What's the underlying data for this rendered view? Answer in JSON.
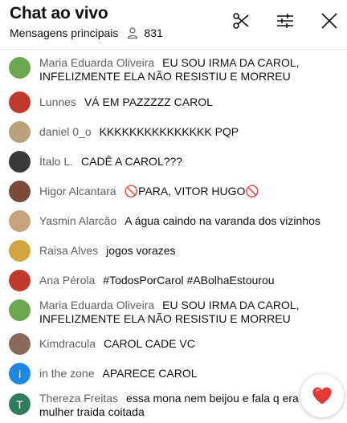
{
  "header": {
    "title": "Chat ao vivo",
    "mode_label": "Mensagens principais",
    "viewer_count": "831"
  },
  "messages": [
    {
      "author": "Maria Eduarda Oliveira",
      "text": "EU SOU IRMA DA CAROL, INFELIZMENTE ELA NÃO RESISTIU E MORREU",
      "avatar": "photo",
      "avatar_color": "#6aa84f"
    },
    {
      "author": "Lunnes",
      "text": "VÁ EM PAZZZZZ CAROL",
      "avatar": "photo",
      "avatar_color": "#c0392b"
    },
    {
      "author": "daniel 0_o",
      "text": "KKKKKKKKKKKKKKK PQP",
      "avatar": "photo",
      "avatar_color": "#b8a27a"
    },
    {
      "author": "Ítalo L.",
      "text": "CADÊ A CAROL???",
      "avatar": "photo",
      "avatar_color": "#3a3a3a"
    },
    {
      "author": "Higor Alcantara",
      "text": "🚫PARA, VITOR HUGO🚫",
      "avatar": "photo",
      "avatar_color": "#7a4a3a"
    },
    {
      "author": "Yasmin Alarcão",
      "text": "A água caindo na varanda dos vizinhos",
      "avatar": "photo",
      "avatar_color": "#c8a27a"
    },
    {
      "author": "Raisa Alves",
      "text": "jogos vorazes",
      "avatar": "photo",
      "avatar_color": "#d4a53c"
    },
    {
      "author": "Ana Pérola",
      "text": "#TodosPorCarol #ABolhaEstourou",
      "avatar": "photo",
      "avatar_color": "#c0392b"
    },
    {
      "author": "Maria Eduarda Oliveira",
      "text": "EU SOU IRMA DA CAROL, INFELIZMENTE ELA NÃO RESISTIU E MORREU",
      "avatar": "photo",
      "avatar_color": "#6aa84f"
    },
    {
      "author": "Kimdracula",
      "text": "CAROL CADE VC",
      "avatar": "photo",
      "avatar_color": "#8a6a5a"
    },
    {
      "author": "in the zone",
      "text": "APARECE CAROL",
      "avatar": "letter",
      "avatar_letter": "i",
      "avatar_color": "#1e88e5"
    },
    {
      "author": "Thereza Freitas",
      "text": "essa mona nem beijou e fala q era mulher traida coitada",
      "avatar": "letter",
      "avatar_letter": "T",
      "avatar_color": "#2e7d5b"
    }
  ],
  "icons": {
    "scissors": "scissors-icon",
    "filter": "sliders-icon",
    "close": "close-icon",
    "viewers": "person-icon",
    "reaction": "heart-icon"
  },
  "colors": {
    "author": "#606060",
    "heart": "#e53935"
  }
}
